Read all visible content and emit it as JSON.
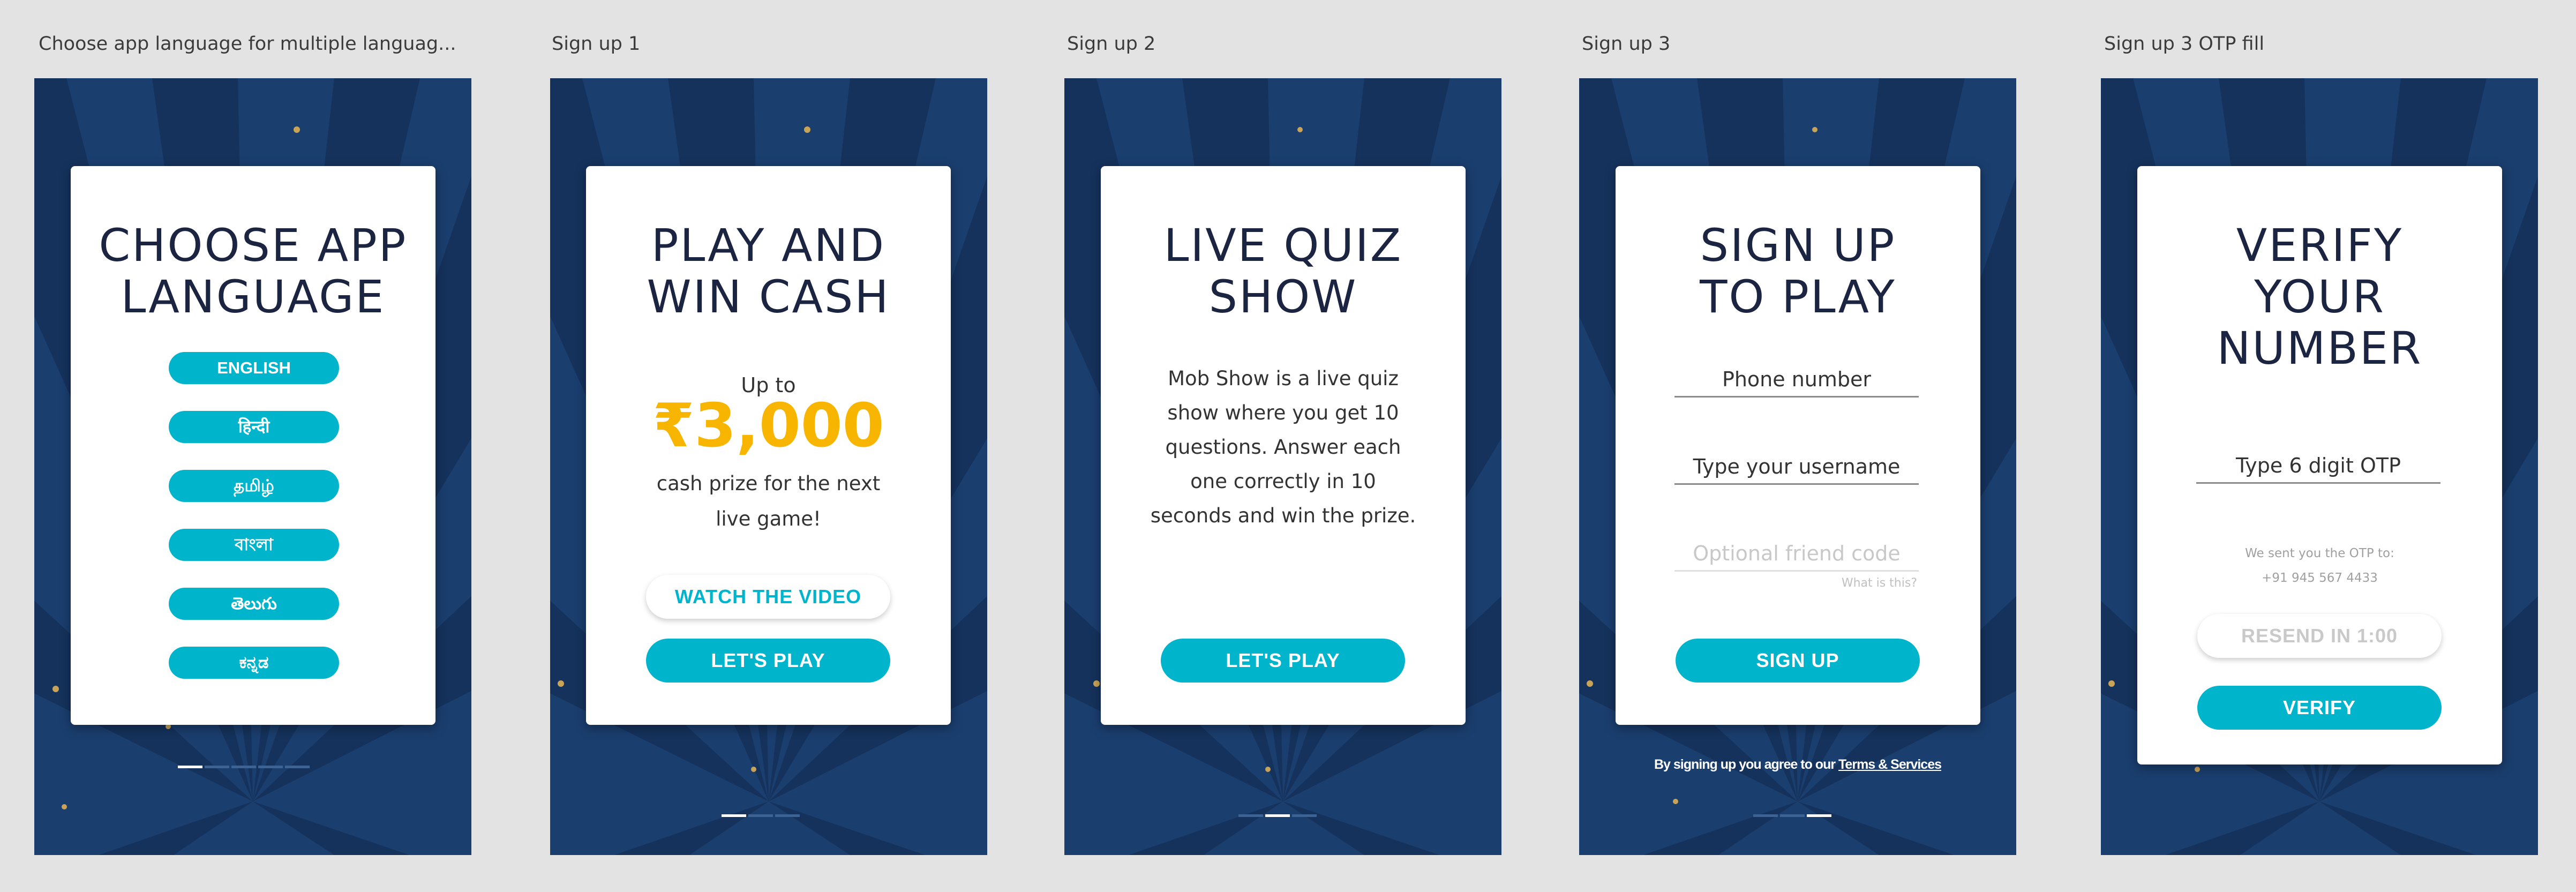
{
  "artboards": [
    {
      "title": "Choose app language for multiple languag...",
      "card_title": "CHOOSE APP\nLANGUAGE",
      "languages": [
        "ENGLISH",
        "हिन्दी",
        "தமிழ்",
        "বাংলা",
        "తెలుగు",
        "ಕನ್ನಡ"
      ],
      "pager_active": 0
    },
    {
      "title": "Sign up 1",
      "card_title": "PLAY AND\nWIN CASH",
      "lead": "Up to",
      "prize": "₹3,000",
      "sub": "cash prize for the next live game!",
      "secondary_button": "WATCH THE VIDEO",
      "primary_button": "LET'S PLAY",
      "pager_active": 0
    },
    {
      "title": "Sign up 2",
      "card_title": "LIVE QUIZ\nSHOW",
      "description": "Mob Show is a live quiz show where you get 10 questions. Answer each one correctly in 10 seconds and win the prize.",
      "primary_button": "LET'S PLAY",
      "pager_active": 1
    },
    {
      "title": "Sign up 3",
      "card_title": "SIGN UP\nTO PLAY",
      "phone_field": "Phone number",
      "username_field": "Type your username",
      "friend_code_placeholder": "Optional friend code",
      "what_is_this": "What is this?",
      "primary_button": "SIGN UP",
      "terms_prefix": "By signing up you agree to our ",
      "terms_link": "Terms & Services",
      "pager_active": 2
    },
    {
      "title": "Sign up 3 OTP fill",
      "card_title": "VERIFY\nYOUR\nNUMBER",
      "otp_field": "Type 6 digit OTP",
      "otp_info_line1": "We sent you the OTP to:",
      "otp_info_line2": "+91 945 567 4433",
      "resend_button": "RESEND IN 1:00",
      "primary_button": "VERIFY"
    }
  ],
  "colors": {
    "background_navy": "#1a3e6e",
    "ray_dark": "#15325c",
    "accent": "#00b4cc",
    "prize": "#f7b500",
    "title_text": "#1b2440"
  }
}
